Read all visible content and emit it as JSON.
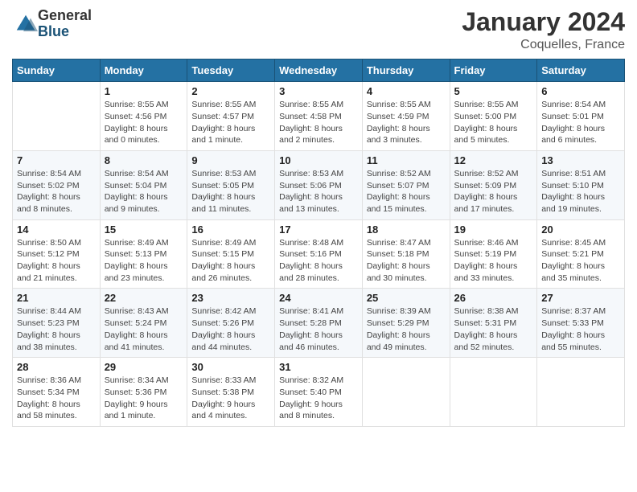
{
  "logo": {
    "general": "General",
    "blue": "Blue"
  },
  "title": "January 2024",
  "location": "Coquelles, France",
  "days_of_week": [
    "Sunday",
    "Monday",
    "Tuesday",
    "Wednesday",
    "Thursday",
    "Friday",
    "Saturday"
  ],
  "weeks": [
    [
      {
        "day": "",
        "info": ""
      },
      {
        "day": "1",
        "info": "Sunrise: 8:55 AM\nSunset: 4:56 PM\nDaylight: 8 hours\nand 0 minutes."
      },
      {
        "day": "2",
        "info": "Sunrise: 8:55 AM\nSunset: 4:57 PM\nDaylight: 8 hours\nand 1 minute."
      },
      {
        "day": "3",
        "info": "Sunrise: 8:55 AM\nSunset: 4:58 PM\nDaylight: 8 hours\nand 2 minutes."
      },
      {
        "day": "4",
        "info": "Sunrise: 8:55 AM\nSunset: 4:59 PM\nDaylight: 8 hours\nand 3 minutes."
      },
      {
        "day": "5",
        "info": "Sunrise: 8:55 AM\nSunset: 5:00 PM\nDaylight: 8 hours\nand 5 minutes."
      },
      {
        "day": "6",
        "info": "Sunrise: 8:54 AM\nSunset: 5:01 PM\nDaylight: 8 hours\nand 6 minutes."
      }
    ],
    [
      {
        "day": "7",
        "info": "Sunrise: 8:54 AM\nSunset: 5:02 PM\nDaylight: 8 hours\nand 8 minutes."
      },
      {
        "day": "8",
        "info": "Sunrise: 8:54 AM\nSunset: 5:04 PM\nDaylight: 8 hours\nand 9 minutes."
      },
      {
        "day": "9",
        "info": "Sunrise: 8:53 AM\nSunset: 5:05 PM\nDaylight: 8 hours\nand 11 minutes."
      },
      {
        "day": "10",
        "info": "Sunrise: 8:53 AM\nSunset: 5:06 PM\nDaylight: 8 hours\nand 13 minutes."
      },
      {
        "day": "11",
        "info": "Sunrise: 8:52 AM\nSunset: 5:07 PM\nDaylight: 8 hours\nand 15 minutes."
      },
      {
        "day": "12",
        "info": "Sunrise: 8:52 AM\nSunset: 5:09 PM\nDaylight: 8 hours\nand 17 minutes."
      },
      {
        "day": "13",
        "info": "Sunrise: 8:51 AM\nSunset: 5:10 PM\nDaylight: 8 hours\nand 19 minutes."
      }
    ],
    [
      {
        "day": "14",
        "info": "Sunrise: 8:50 AM\nSunset: 5:12 PM\nDaylight: 8 hours\nand 21 minutes."
      },
      {
        "day": "15",
        "info": "Sunrise: 8:49 AM\nSunset: 5:13 PM\nDaylight: 8 hours\nand 23 minutes."
      },
      {
        "day": "16",
        "info": "Sunrise: 8:49 AM\nSunset: 5:15 PM\nDaylight: 8 hours\nand 26 minutes."
      },
      {
        "day": "17",
        "info": "Sunrise: 8:48 AM\nSunset: 5:16 PM\nDaylight: 8 hours\nand 28 minutes."
      },
      {
        "day": "18",
        "info": "Sunrise: 8:47 AM\nSunset: 5:18 PM\nDaylight: 8 hours\nand 30 minutes."
      },
      {
        "day": "19",
        "info": "Sunrise: 8:46 AM\nSunset: 5:19 PM\nDaylight: 8 hours\nand 33 minutes."
      },
      {
        "day": "20",
        "info": "Sunrise: 8:45 AM\nSunset: 5:21 PM\nDaylight: 8 hours\nand 35 minutes."
      }
    ],
    [
      {
        "day": "21",
        "info": "Sunrise: 8:44 AM\nSunset: 5:23 PM\nDaylight: 8 hours\nand 38 minutes."
      },
      {
        "day": "22",
        "info": "Sunrise: 8:43 AM\nSunset: 5:24 PM\nDaylight: 8 hours\nand 41 minutes."
      },
      {
        "day": "23",
        "info": "Sunrise: 8:42 AM\nSunset: 5:26 PM\nDaylight: 8 hours\nand 44 minutes."
      },
      {
        "day": "24",
        "info": "Sunrise: 8:41 AM\nSunset: 5:28 PM\nDaylight: 8 hours\nand 46 minutes."
      },
      {
        "day": "25",
        "info": "Sunrise: 8:39 AM\nSunset: 5:29 PM\nDaylight: 8 hours\nand 49 minutes."
      },
      {
        "day": "26",
        "info": "Sunrise: 8:38 AM\nSunset: 5:31 PM\nDaylight: 8 hours\nand 52 minutes."
      },
      {
        "day": "27",
        "info": "Sunrise: 8:37 AM\nSunset: 5:33 PM\nDaylight: 8 hours\nand 55 minutes."
      }
    ],
    [
      {
        "day": "28",
        "info": "Sunrise: 8:36 AM\nSunset: 5:34 PM\nDaylight: 8 hours\nand 58 minutes."
      },
      {
        "day": "29",
        "info": "Sunrise: 8:34 AM\nSunset: 5:36 PM\nDaylight: 9 hours\nand 1 minute."
      },
      {
        "day": "30",
        "info": "Sunrise: 8:33 AM\nSunset: 5:38 PM\nDaylight: 9 hours\nand 4 minutes."
      },
      {
        "day": "31",
        "info": "Sunrise: 8:32 AM\nSunset: 5:40 PM\nDaylight: 9 hours\nand 8 minutes."
      },
      {
        "day": "",
        "info": ""
      },
      {
        "day": "",
        "info": ""
      },
      {
        "day": "",
        "info": ""
      }
    ]
  ]
}
